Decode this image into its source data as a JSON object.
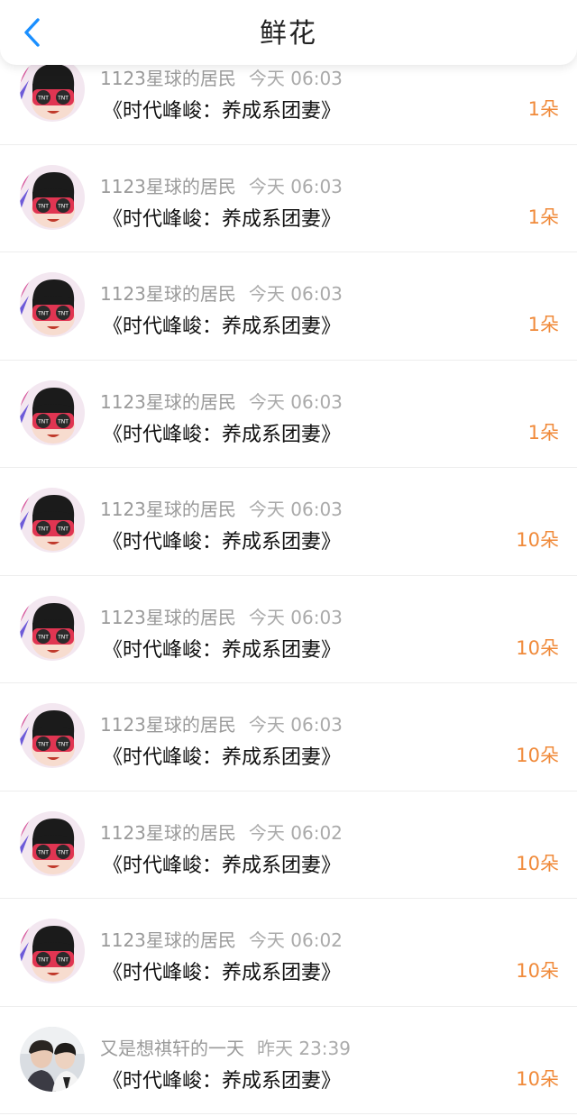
{
  "header": {
    "title": "鲜花",
    "back_icon": "chevron-left-icon",
    "accent_color": "#1a8fff"
  },
  "colors": {
    "amount": "#f08a3a",
    "meta": "#9a9a9a"
  },
  "items": [
    {
      "user": "1123星球的居民",
      "time": "今天 06:03",
      "book": "《时代峰峻：养成系团妻》",
      "amount": "1朵",
      "avatar": "cartoon-avatar"
    },
    {
      "user": "1123星球的居民",
      "time": "今天 06:03",
      "book": "《时代峰峻：养成系团妻》",
      "amount": "1朵",
      "avatar": "cartoon-avatar"
    },
    {
      "user": "1123星球的居民",
      "time": "今天 06:03",
      "book": "《时代峰峻：养成系团妻》",
      "amount": "1朵",
      "avatar": "cartoon-avatar"
    },
    {
      "user": "1123星球的居民",
      "time": "今天 06:03",
      "book": "《时代峰峻：养成系团妻》",
      "amount": "1朵",
      "avatar": "cartoon-avatar"
    },
    {
      "user": "1123星球的居民",
      "time": "今天 06:03",
      "book": "《时代峰峻：养成系团妻》",
      "amount": "10朵",
      "avatar": "cartoon-avatar"
    },
    {
      "user": "1123星球的居民",
      "time": "今天 06:03",
      "book": "《时代峰峻：养成系团妻》",
      "amount": "10朵",
      "avatar": "cartoon-avatar"
    },
    {
      "user": "1123星球的居民",
      "time": "今天 06:03",
      "book": "《时代峰峻：养成系团妻》",
      "amount": "10朵",
      "avatar": "cartoon-avatar"
    },
    {
      "user": "1123星球的居民",
      "time": "今天 06:02",
      "book": "《时代峰峻：养成系团妻》",
      "amount": "10朵",
      "avatar": "cartoon-avatar"
    },
    {
      "user": "1123星球的居民",
      "time": "今天 06:02",
      "book": "《时代峰峻：养成系团妻》",
      "amount": "10朵",
      "avatar": "cartoon-avatar"
    },
    {
      "user": "又是想祺轩的一天",
      "time": "昨天 23:39",
      "book": "《时代峰峻：养成系团妻》",
      "amount": "10朵",
      "avatar": "photo-avatar"
    }
  ]
}
